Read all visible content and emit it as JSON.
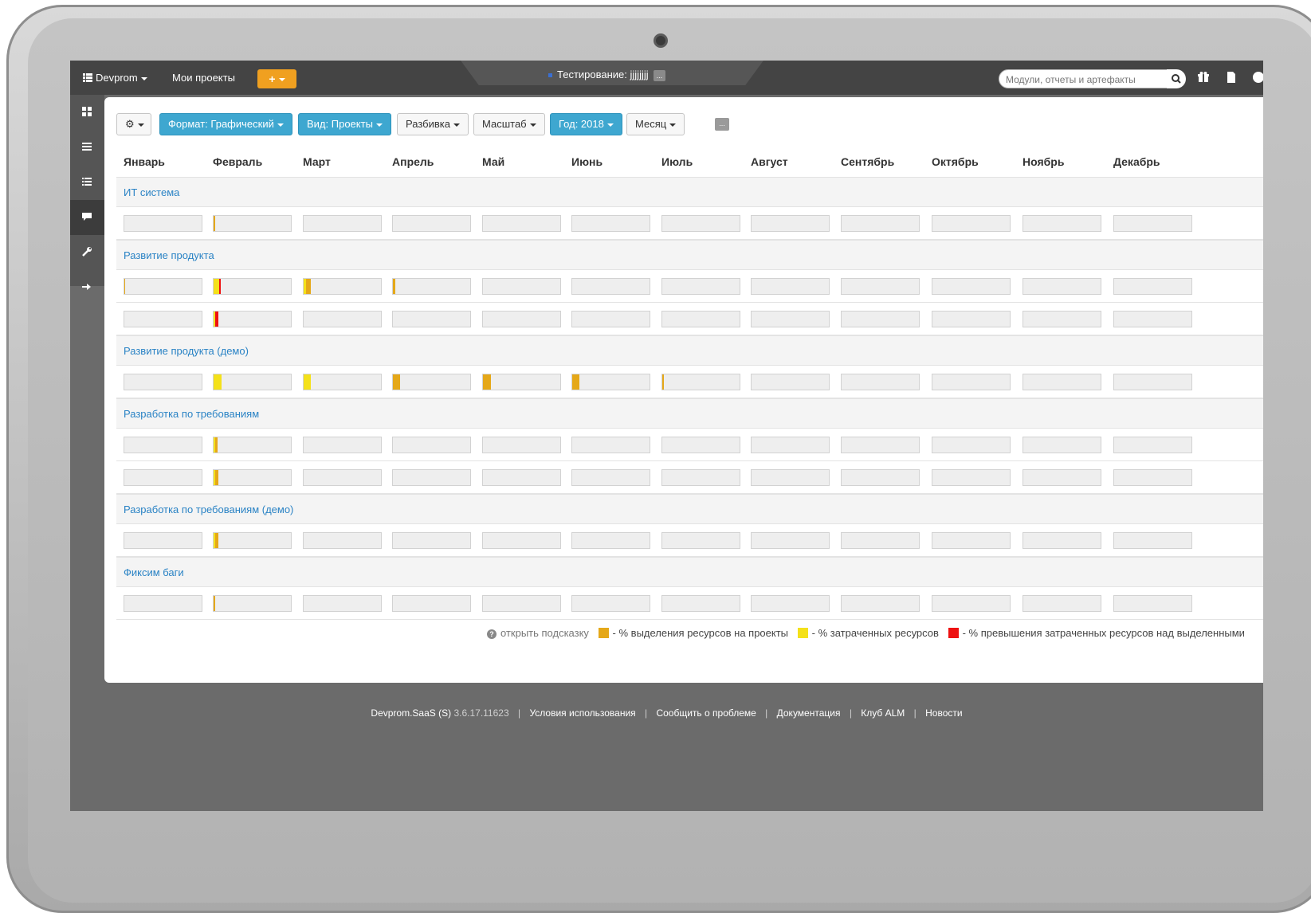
{
  "topbar": {
    "brand": "Devprom",
    "my_projects": "Мои проекты",
    "plus_label": "+",
    "project_label": "Тестирование:",
    "project_name": "jjjjjjjj",
    "project_more": "...",
    "search_placeholder": "Модули, отчеты и артефакты"
  },
  "toolbar": {
    "settings": "⚙",
    "format": "Формат: Графический",
    "view": "Вид: Проекты",
    "breakdown": "Разбивка",
    "scale": "Масштаб",
    "year": "Год: 2018",
    "month": "Месяц",
    "more": "..."
  },
  "months": [
    "Январь",
    "Февраль",
    "Март",
    "Апрель",
    "Май",
    "Июнь",
    "Июль",
    "Август",
    "Сентябрь",
    "Октябрь",
    "Ноябрь",
    "Декабрь"
  ],
  "sections": [
    {
      "title": "ИТ система",
      "rows": [
        [
          null,
          [
            {
              "c": "allocated",
              "p": 2
            }
          ],
          null,
          null,
          null,
          null,
          null,
          null,
          null,
          null,
          null,
          null
        ]
      ]
    },
    {
      "title": "Развитие продукта",
      "rows": [
        [
          [
            {
              "c": "allocated",
              "p": 1
            }
          ],
          [
            {
              "c": "spent",
              "p": 7
            },
            {
              "c": "over",
              "p": 2
            }
          ],
          [
            {
              "c": "spent",
              "p": 3
            },
            {
              "c": "allocated",
              "p": 6
            }
          ],
          [
            {
              "c": "allocated",
              "p": 3
            }
          ],
          null,
          null,
          null,
          null,
          null,
          null,
          null,
          null
        ],
        [
          null,
          [
            {
              "c": "spent",
              "p": 2
            },
            {
              "c": "over",
              "p": 4
            }
          ],
          null,
          null,
          null,
          null,
          null,
          null,
          null,
          null,
          null,
          null
        ]
      ]
    },
    {
      "title": "Развитие продукта (демо)",
      "rows": [
        [
          null,
          [
            {
              "c": "spent",
              "p": 10
            }
          ],
          [
            {
              "c": "spent",
              "p": 9
            }
          ],
          [
            {
              "c": "allocated",
              "p": 9
            }
          ],
          [
            {
              "c": "allocated",
              "p": 10
            }
          ],
          [
            {
              "c": "allocated",
              "p": 9
            }
          ],
          [
            {
              "c": "allocated",
              "p": 2
            }
          ],
          null,
          null,
          null,
          null,
          null
        ]
      ]
    },
    {
      "title": "Разработка по требованиям",
      "rows": [
        [
          null,
          [
            {
              "c": "spent",
              "p": 2
            },
            {
              "c": "allocated",
              "p": 3
            }
          ],
          null,
          null,
          null,
          null,
          null,
          null,
          null,
          null,
          null,
          null
        ],
        [
          null,
          [
            {
              "c": "spent",
              "p": 2
            },
            {
              "c": "allocated",
              "p": 4
            }
          ],
          null,
          null,
          null,
          null,
          null,
          null,
          null,
          null,
          null,
          null
        ]
      ]
    },
    {
      "title": "Разработка по требованиям (демо)",
      "rows": [
        [
          null,
          [
            {
              "c": "spent",
              "p": 2
            },
            {
              "c": "allocated",
              "p": 4
            }
          ],
          null,
          null,
          null,
          null,
          null,
          null,
          null,
          null,
          null,
          null
        ]
      ]
    },
    {
      "title": "Фиксим баги",
      "rows": [
        [
          null,
          [
            {
              "c": "allocated",
              "p": 2
            }
          ],
          null,
          null,
          null,
          null,
          null,
          null,
          null,
          null,
          null,
          null
        ]
      ]
    }
  ],
  "legend": {
    "hint": "открыть подсказку",
    "allocated": "- % выделения ресурсов на проекты",
    "spent": "- % затраченных ресурсов",
    "over": "- % превышения затраченных ресурсов над выделенными"
  },
  "colors": {
    "allocated": "#e5a819",
    "spent": "#f4e11a",
    "over": "#ee1111"
  },
  "footer": {
    "product": "Devprom.SaaS (S)",
    "version": "3.6.17.11623",
    "links": [
      "Условия использования",
      "Сообщить о проблеме",
      "Документация",
      "Клуб ALM",
      "Новости"
    ]
  }
}
